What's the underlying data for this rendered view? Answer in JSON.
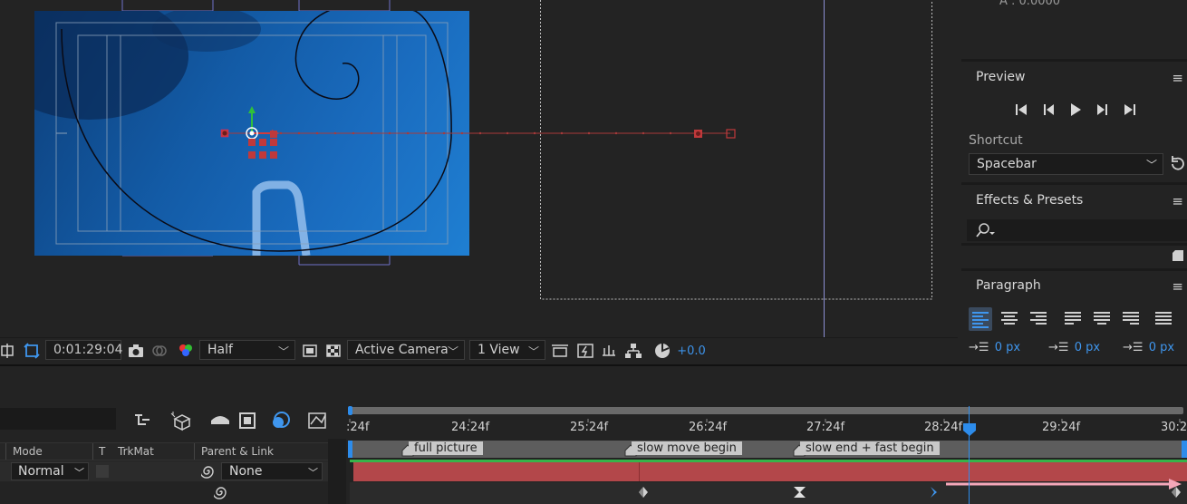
{
  "toolbar": {
    "timecode": "0:01:29:04",
    "resolution": "Half",
    "camera": "Active Camera",
    "views": "1 View",
    "exposure": "+0.0"
  },
  "right_panel": {
    "top_value": "A : 0.0000",
    "preview": {
      "title": "Preview"
    },
    "shortcut": {
      "label": "Shortcut",
      "value": "Spacebar"
    },
    "effects": {
      "title": "Effects & Presets",
      "search_placeholder": ""
    },
    "paragraph": {
      "title": "Paragraph",
      "indent_left": "0 px",
      "space_before": "0 px",
      "indent_first": "0 px"
    }
  },
  "timeline": {
    "columns": {
      "mode": "Mode",
      "t": "T",
      "trkmat": "TrkMat",
      "parent": "Parent & Link"
    },
    "layer": {
      "mode": "Normal",
      "parent": "None"
    },
    "ruler": [
      ":24f",
      "24:24f",
      "25:24f",
      "26:24f",
      "27:24f",
      "28:24f",
      "29:24f",
      "30:2"
    ],
    "markers": [
      "full picture",
      "slow move begin",
      "slow end + fast begin"
    ]
  },
  "colors": {
    "accent": "#2d8ceb",
    "layer_bar": "#b3474a",
    "marker": "#c8c8c8",
    "arrow": "#f4a7b9"
  }
}
